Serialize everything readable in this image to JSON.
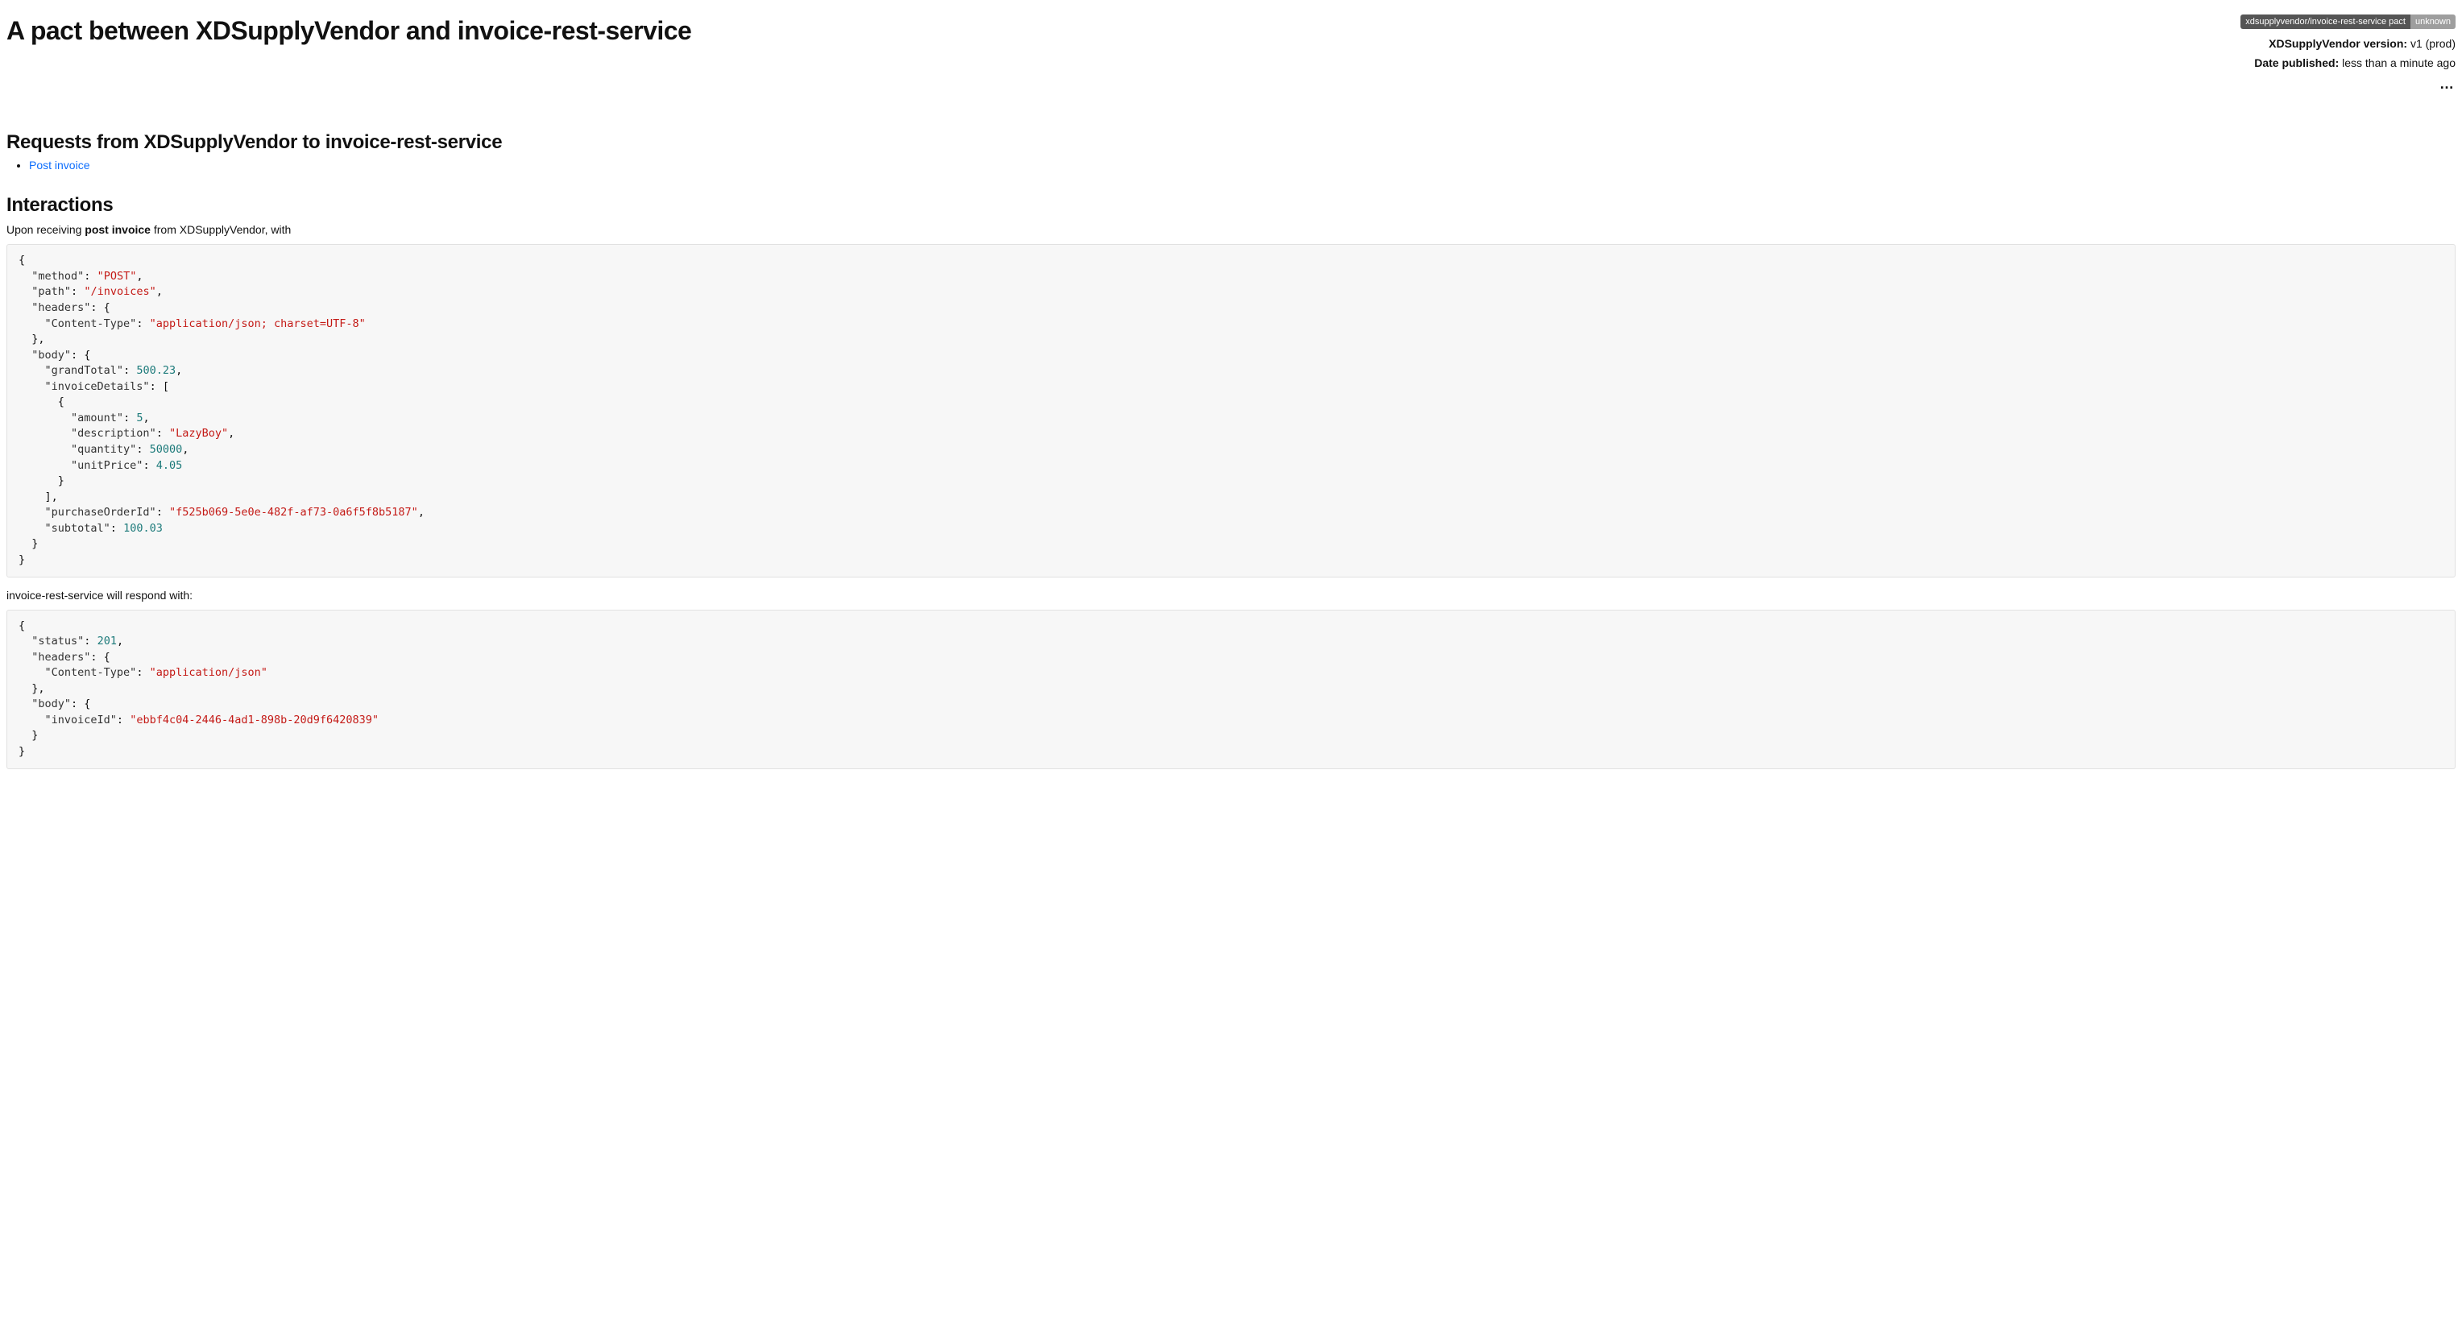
{
  "title": "A pact between XDSupplyVendor and invoice-rest-service",
  "badge": {
    "left": "xdsupplyvendor/invoice-rest-service pact",
    "right": "unknown"
  },
  "meta": {
    "version_label": "XDSupplyVendor version:",
    "version_value": "v1 (prod)",
    "published_label": "Date published:",
    "published_value": "less than a minute ago"
  },
  "dots": "…",
  "requests_heading": "Requests from XDSupplyVendor to invoice-rest-service",
  "request_links": [
    {
      "label": "Post invoice"
    }
  ],
  "interactions_heading": "Interactions",
  "interaction": {
    "upon_prefix": "Upon receiving ",
    "upon_bold": "post invoice",
    "upon_suffix": " from XDSupplyVendor, with",
    "respond_text": "invoice-rest-service will respond with:"
  },
  "request_json": {
    "method": "POST",
    "path": "/invoices",
    "headers": {
      "Content-Type": "application/json; charset=UTF-8"
    },
    "body": {
      "grandTotal": 500.23,
      "invoiceDetails": [
        {
          "amount": 5,
          "description": "LazyBoy",
          "quantity": 50000,
          "unitPrice": 4.05
        }
      ],
      "purchaseOrderId": "f525b069-5e0e-482f-af73-0a6f5f8b5187",
      "subtotal": 100.03
    }
  },
  "response_json": {
    "status": 201,
    "headers": {
      "Content-Type": "application/json"
    },
    "body": {
      "invoiceId": "ebbf4c04-2446-4ad1-898b-20d9f6420839"
    }
  }
}
